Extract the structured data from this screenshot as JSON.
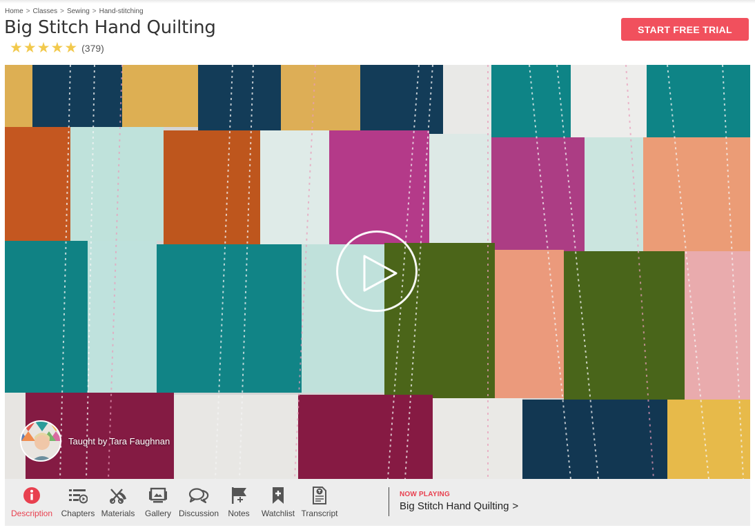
{
  "breadcrumb": {
    "items": [
      "Home",
      "Classes",
      "Sewing",
      "Hand-stitching"
    ],
    "separator": ">"
  },
  "page_title": "Big Stitch Hand Quilting",
  "rating": {
    "stars": 5,
    "count_label": "(379)",
    "star_color": "#f2c94c"
  },
  "cta": {
    "label": "START FREE TRIAL",
    "color": "#f1505d"
  },
  "video": {
    "instructor_label": "Taught by Tara Faughnan",
    "play_icon": "play-icon"
  },
  "toolbar": {
    "tabs": [
      {
        "label": "Description",
        "icon": "info-icon"
      },
      {
        "label": "Chapters",
        "icon": "chapters-icon"
      },
      {
        "label": "Materials",
        "icon": "materials-icon"
      },
      {
        "label": "Gallery",
        "icon": "gallery-icon"
      },
      {
        "label": "Discussion",
        "icon": "discussion-icon"
      },
      {
        "label": "Notes",
        "icon": "notes-icon"
      },
      {
        "label": "Watchlist",
        "icon": "watchlist-icon"
      },
      {
        "label": "Transcript",
        "icon": "transcript-icon"
      }
    ],
    "now_playing_label": "NOW PLAYING",
    "now_playing_title": "Big Stitch Hand Quilting",
    "now_playing_chevron": ">",
    "accent": "#e8404f"
  }
}
